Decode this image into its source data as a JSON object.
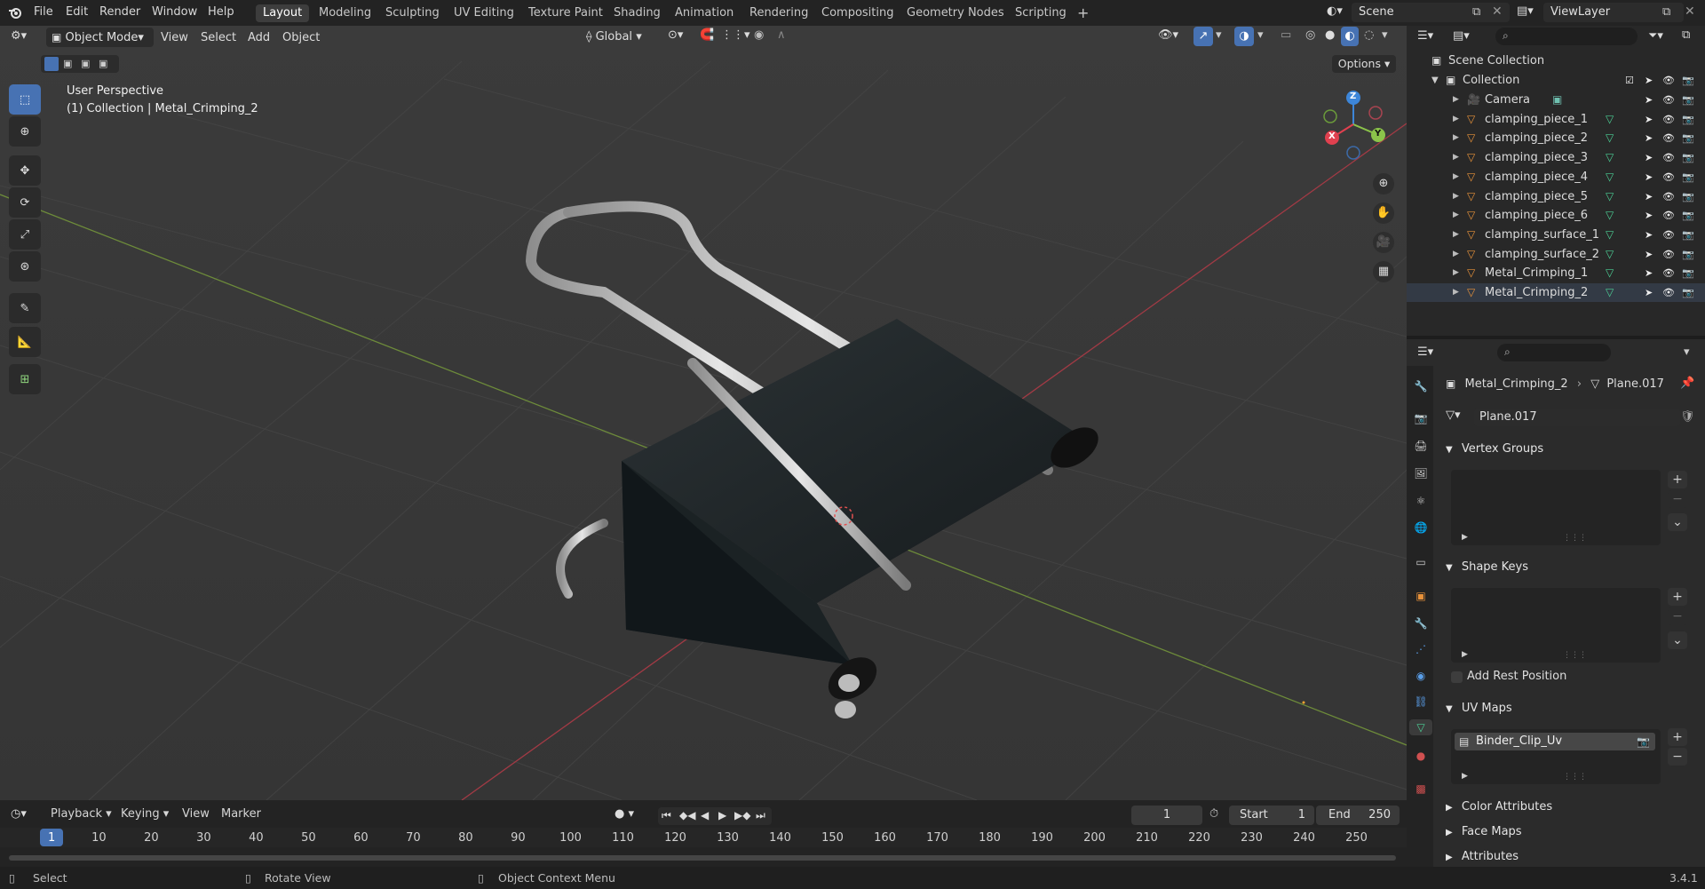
{
  "top_menu": [
    "File",
    "Edit",
    "Render",
    "Window",
    "Help"
  ],
  "workspaces": [
    "Layout",
    "Modeling",
    "Sculpting",
    "UV Editing",
    "Texture Paint",
    "Shading",
    "Animation",
    "Rendering",
    "Compositing",
    "Geometry Nodes",
    "Scripting"
  ],
  "add_workspace": "+",
  "scene_name": "Scene",
  "view_layer": "ViewLayer",
  "viewport": {
    "mode": "Object Mode",
    "menus": [
      "View",
      "Select",
      "Add",
      "Object"
    ],
    "transform_orientation": "Global",
    "options_label": "Options",
    "view_title": "User Perspective",
    "view_subtitle": "(1) Collection | Metal_Crimping_2",
    "gizmo": {
      "x": "X",
      "y": "Y",
      "z": "Z"
    }
  },
  "outliner": {
    "scene_collection": "Scene Collection",
    "collection": "Collection",
    "items": [
      "Camera",
      "clamping_piece_1",
      "clamping_piece_2",
      "clamping_piece_3",
      "clamping_piece_4",
      "clamping_piece_5",
      "clamping_piece_6",
      "clamping_surface_1",
      "clamping_surface_2",
      "Metal_Crimping_1",
      "Metal_Crimping_2"
    ]
  },
  "properties": {
    "breadcrumb_object": "Metal_Crimping_2",
    "breadcrumb_mesh": "Plane.017",
    "mesh_name": "Plane.017",
    "panels": {
      "vertex_groups": "Vertex Groups",
      "shape_keys": "Shape Keys",
      "add_rest_position": "Add Rest Position",
      "uv_maps": "UV Maps",
      "uv_map_item": "Binder_Clip_Uv",
      "color_attributes": "Color Attributes",
      "face_maps": "Face Maps",
      "attributes": "Attributes"
    }
  },
  "timeline": {
    "menus": [
      "Playback",
      "Keying",
      "View",
      "Marker"
    ],
    "current_frame": "1",
    "start_label": "Start",
    "start": "1",
    "end_label": "End",
    "end": "250",
    "ticks": [
      "1",
      "10",
      "20",
      "30",
      "40",
      "50",
      "60",
      "70",
      "80",
      "90",
      "100",
      "110",
      "120",
      "130",
      "140",
      "150",
      "160",
      "170",
      "180",
      "190",
      "200",
      "210",
      "220",
      "230",
      "240",
      "250"
    ]
  },
  "status": {
    "select": "Select",
    "rotate": "Rotate View",
    "context": "Object Context Menu",
    "version": "3.4.1"
  },
  "colors": {
    "accent": "#4772b3",
    "x_axis": "#e0404f",
    "y_axis": "#8bc34a",
    "z_axis": "#3d86d9",
    "mesh_icon": "#e8923a"
  }
}
